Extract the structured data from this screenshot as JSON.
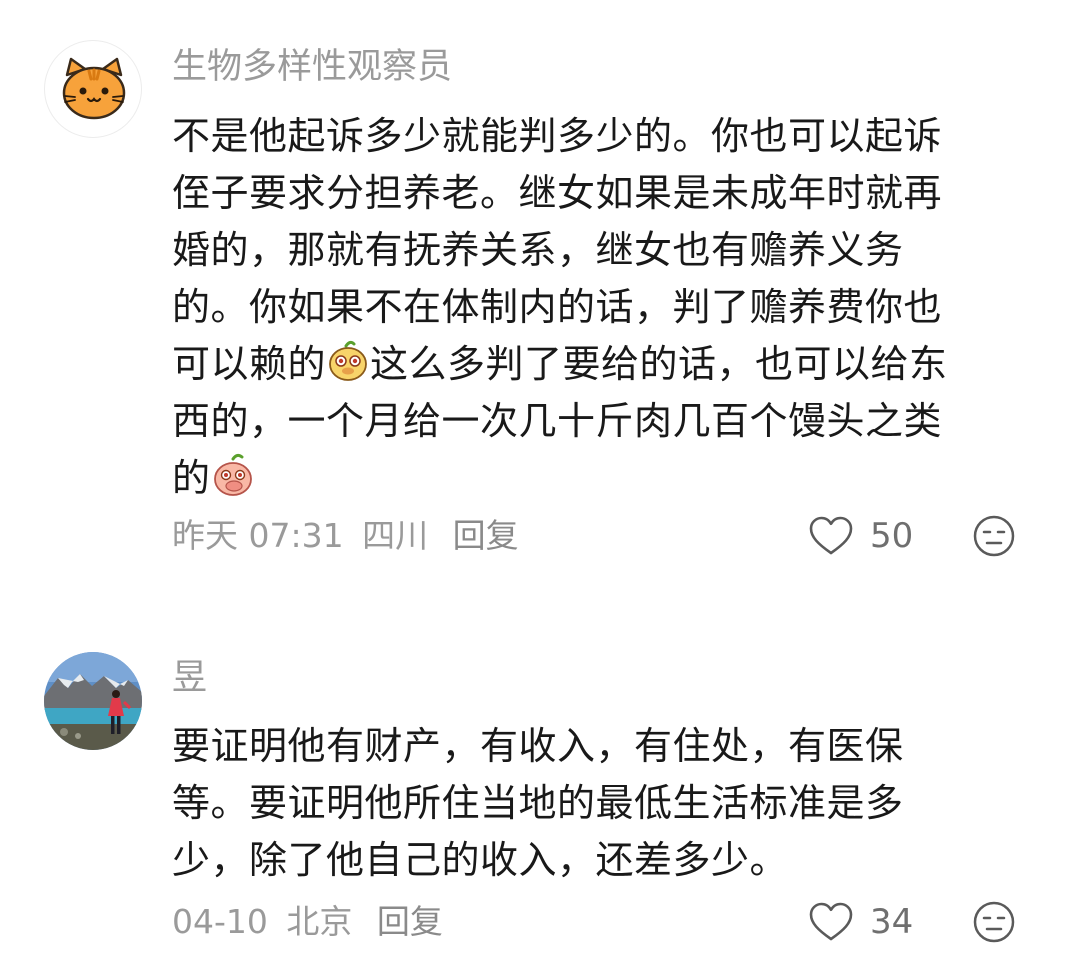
{
  "comments": [
    {
      "username": "生物多样性观察员",
      "avatar_icon": "orange-cat-icon",
      "lines": [
        "不是他起诉多少就能判多少的。你也可以起诉",
        "侄子要求分担养老。继女如果是未成年时就再",
        "婚的，那就有抚养关系，继女也有赡养义务",
        "的。你如果不在体制内的话，判了赡养费你也"
      ],
      "line5_before": "可以赖的",
      "line5_after": "这么多判了要给的话，也可以给东",
      "line6": "西的，一个月给一次几十斤肉几百个馒头之类",
      "line7": "的",
      "time": "昨天 07:31",
      "location": "四川",
      "reply_label": "回复",
      "likes": "50"
    },
    {
      "username": "昱",
      "avatar_icon": "landscape-photo-avatar",
      "lines": [
        "要证明他有财产，有收入，有住处，有医保",
        "等。要证明他所住当地的最低生活标准是多",
        "少，除了他自己的收入，还差多少。"
      ],
      "time": "04-10",
      "location": "北京",
      "reply_label": "回复",
      "likes": "34"
    }
  ],
  "colors": {
    "meta_gray": "#9a9a9a",
    "text": "#191919",
    "cat_orange": "#f7a23b"
  }
}
